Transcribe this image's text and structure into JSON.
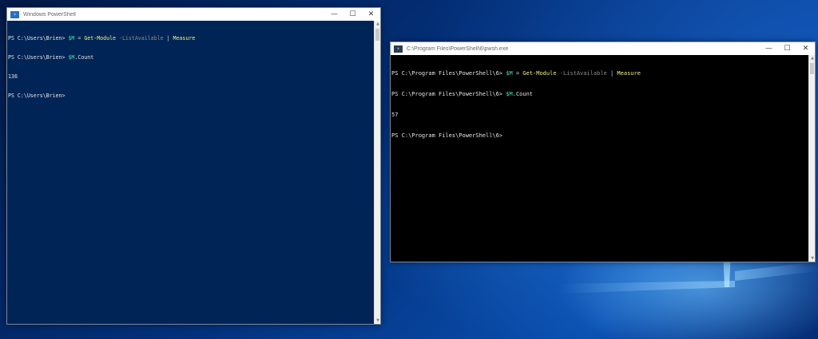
{
  "windows": [
    {
      "title": "Windows PowerShell",
      "icon": "powershell-icon",
      "caption": {
        "minimize": "—",
        "maximize": "☐",
        "close": "✕"
      },
      "lines": [
        {
          "prompt": "PS C:\\Users\\Brien> ",
          "var": "$M",
          "eq": " = ",
          "cmd": "Get-Module",
          "param": " -ListAvailable",
          "pipe": " | ",
          "cmd2": "Measure"
        },
        {
          "prompt": "PS C:\\Users\\Brien> ",
          "var": "$M",
          "rest": ".Count"
        },
        {
          "plain": "136"
        },
        {
          "plain": "PS C:\\Users\\Brien>"
        }
      ]
    },
    {
      "title": "C:\\Program Files\\PowerShell\\6\\pwsh.exe",
      "icon": "powershell-core-icon",
      "caption": {
        "minimize": "—",
        "maximize": "☐",
        "close": "✕"
      },
      "lines": [
        {
          "prompt": "PS C:\\Program Files\\PowerShell\\6> ",
          "var": "$M",
          "eq": " = ",
          "cmd": "Get-Module",
          "param": " -ListAvailable",
          "pipe": " | ",
          "cmd2": "Measure"
        },
        {
          "prompt": "PS C:\\Program Files\\PowerShell\\6> ",
          "var": "$M",
          "rest": ".Count"
        },
        {
          "plain": "57"
        },
        {
          "plain": "PS C:\\Program Files\\PowerShell\\6>"
        }
      ]
    }
  ],
  "colors": {
    "powershell_bg": "#012456",
    "pwsh_bg": "#000000",
    "variable": "#4fe0a8",
    "command": "#f3f37a",
    "parameter": "#8c8c8c"
  }
}
